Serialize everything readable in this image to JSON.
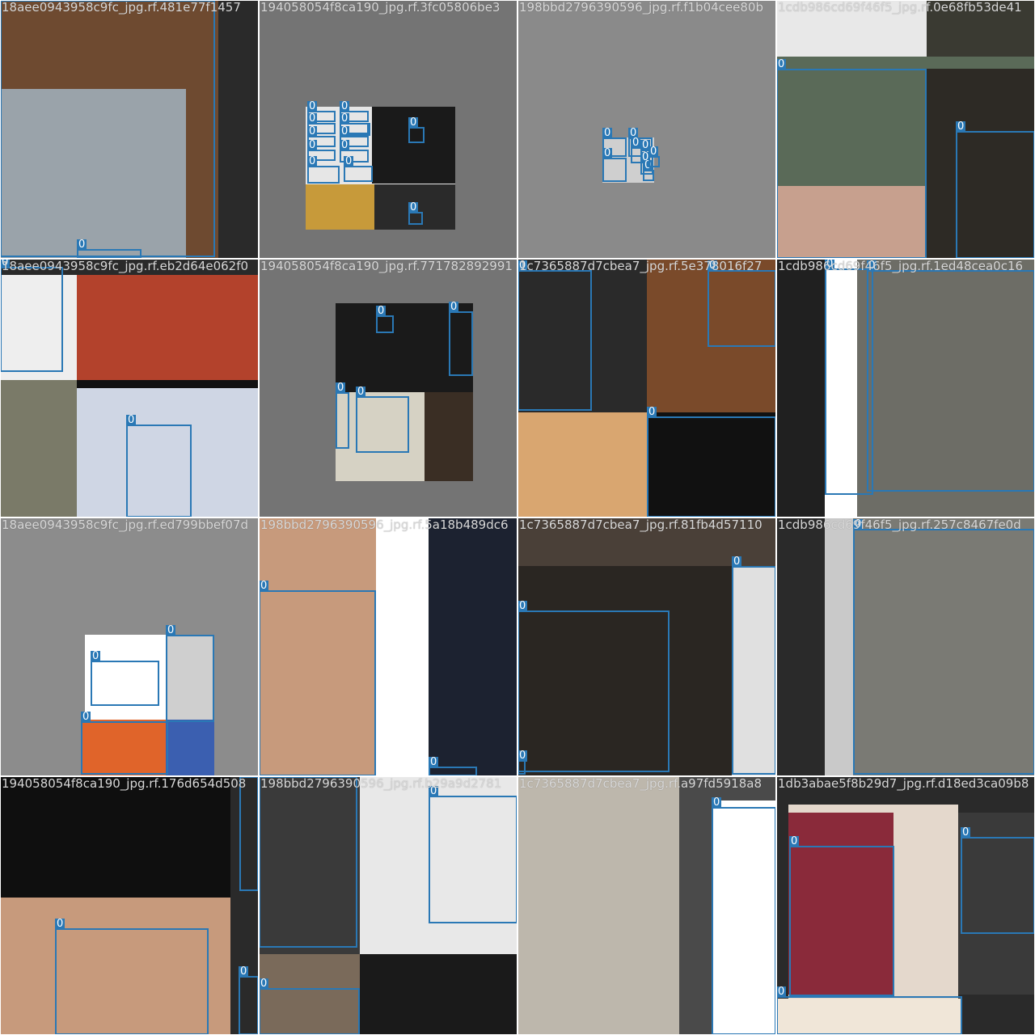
{
  "grid": {
    "tiles": [
      {
        "caption": "18aee0943958c9fc_jpg.rf.481e77f1457",
        "backgrounds": [
          "#8a5a3a",
          "#6e4a30",
          "#2a2a2a",
          "#9aa3aa"
        ],
        "boxes": [
          {
            "label": "0"
          },
          {
            "label": "0"
          }
        ]
      },
      {
        "caption": "194058054f8ca190_jpg.rf.3fc05806be3",
        "backgrounds": [
          "#747474",
          "#e6e6e6",
          "#1a1a1a",
          "#c79a3a",
          "#2a2a2a"
        ],
        "boxes": [
          {
            "label": "0"
          },
          {
            "label": "0"
          },
          {
            "label": "0"
          },
          {
            "label": "0"
          },
          {
            "label": "0"
          },
          {
            "label": "0"
          },
          {
            "label": "0"
          },
          {
            "label": "0"
          },
          {
            "label": "0"
          },
          {
            "label": "0"
          },
          {
            "label": "0"
          },
          {
            "label": "0"
          },
          {
            "label": "0"
          }
        ]
      },
      {
        "caption": "198bbd2796390596_jpg.rf.f1b04cee80b",
        "backgrounds": [
          "#8a8a8a",
          "#cfcfcf"
        ],
        "boxes": [
          {
            "label": "0"
          },
          {
            "label": "0"
          },
          {
            "label": "0"
          },
          {
            "label": "0"
          },
          {
            "label": "0"
          },
          {
            "label": "0"
          },
          {
            "label": "0"
          },
          {
            "label": "0"
          }
        ]
      },
      {
        "caption": "1cdb986cd69f46f5_jpg.rf.0e68fb53de41",
        "backgrounds": [
          "#e8e8e8",
          "#3a3a32",
          "#5a6a58",
          "#2d2a25",
          "#c7a08e"
        ],
        "boxes": [
          {
            "label": "0"
          },
          {
            "label": "0"
          }
        ]
      },
      {
        "caption": "18aee0943958c9fc_jpg.rf.eb2d64e062f0",
        "backgrounds": [
          "#eeeeee",
          "#b3422c",
          "#7a7a68",
          "#cfd6e4",
          "#2a2a2a"
        ],
        "boxes": [
          {
            "label": "0"
          },
          {
            "label": "0"
          }
        ]
      },
      {
        "caption": "194058054f8ca190_jpg.rf.771782892991",
        "backgrounds": [
          "#747474",
          "#1a1a1a",
          "#d6d2c4",
          "#3a2e24"
        ],
        "boxes": [
          {
            "label": "0"
          },
          {
            "label": "0"
          },
          {
            "label": "0"
          },
          {
            "label": "0"
          }
        ]
      },
      {
        "caption": "1c7365887d7cbea7_jpg.rf.5e378016f27",
        "backgrounds": [
          "#6f7a62",
          "#2a2a2a",
          "#7a4a2a",
          "#d9a670",
          "#111111"
        ],
        "boxes": [
          {
            "label": "0"
          },
          {
            "label": "0"
          },
          {
            "label": "0"
          }
        ]
      },
      {
        "caption": "1cdb986cd69f46f5_jpg.rf.1ed48cea0c16",
        "backgrounds": [
          "#8a8578",
          "#202020",
          "#ffffff",
          "#6d6d66"
        ],
        "boxes": [
          {
            "label": "0"
          },
          {
            "label": "0"
          }
        ]
      },
      {
        "caption": "18aee0943958c9fc_jpg.rf.ed799bbef07d",
        "backgrounds": [
          "#8c8c8c",
          "#ffffff",
          "#cfcfcf",
          "#e0642a",
          "#3b5fb0"
        ],
        "boxes": [
          {
            "label": "0"
          },
          {
            "label": "0"
          },
          {
            "label": "0"
          }
        ]
      },
      {
        "caption": "198bbd2796390596_jpg.rf.5a18b489dc6",
        "backgrounds": [
          "#ffffff",
          "#c79a7c",
          "#1c2230"
        ],
        "boxes": [
          {
            "label": "0"
          },
          {
            "label": "0"
          }
        ]
      },
      {
        "caption": "1c7365887d7cbea7_jpg.rf.81fb4d57110",
        "backgrounds": [
          "#4a4038",
          "#2a2622",
          "#e0e0e0"
        ],
        "boxes": [
          {
            "label": "0"
          },
          {
            "label": "0"
          },
          {
            "label": "0"
          }
        ]
      },
      {
        "caption": "1cdb986cd69f46f5_jpg.rf.257c8467fe0d",
        "backgrounds": [
          "#c9c9c9",
          "#7a7a74",
          "#2a2a2a"
        ],
        "boxes": [
          {
            "label": "0"
          }
        ]
      },
      {
        "caption": "194058054f8ca190_jpg.rf.176d654d508",
        "backgrounds": [
          "#0f0f0f",
          "#c79a7c",
          "#2a2a2a"
        ],
        "boxes": [
          {
            "label": "0"
          },
          {
            "label": "0"
          },
          {
            "label": "0"
          }
        ]
      },
      {
        "caption": "198bbd2796390596_jpg.rf.b29a9d2781",
        "backgrounds": [
          "#3a3a3a",
          "#e8e8e8",
          "#7a6a5a",
          "#1a1a1a"
        ],
        "boxes": [
          {
            "label": "0"
          },
          {
            "label": "0"
          },
          {
            "label": "0"
          }
        ]
      },
      {
        "caption": "1c7365887d7cbea7_jpg.rf.a97fd5918a8",
        "backgrounds": [
          "#bdb7ac",
          "#4a4a4a",
          "#ffffff"
        ],
        "boxes": [
          {
            "label": "0"
          }
        ]
      },
      {
        "caption": "1db3abae5f8b29d7_jpg.rf.d18ed3ca09b8",
        "backgrounds": [
          "#2a2a2a",
          "#e4d8cc",
          "#8a2a3a",
          "#3a3a3a",
          "#f0e6d8"
        ],
        "boxes": [
          {
            "label": "0"
          },
          {
            "label": "0"
          },
          {
            "label": "0"
          }
        ]
      }
    ]
  }
}
